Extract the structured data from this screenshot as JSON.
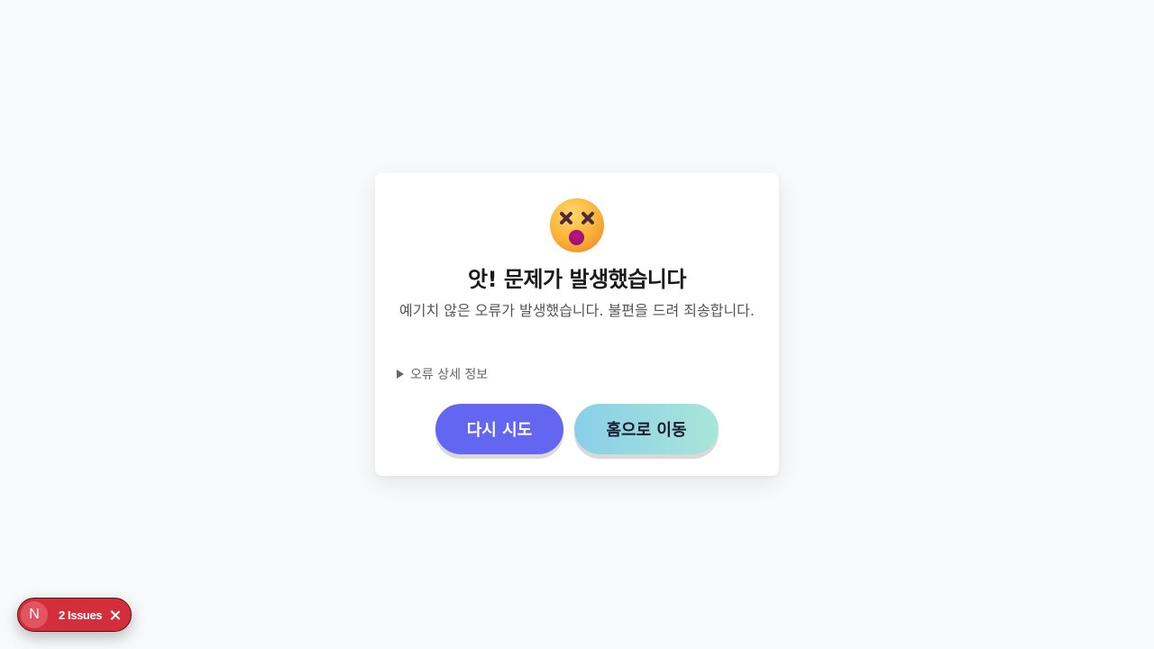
{
  "error_card": {
    "icon": "dizzy-face-emoji-icon",
    "title": "앗! 문제가 발생했습니다",
    "message": "예기치 않은 오류가 발생했습니다. 불편을 드려 죄송합니다.",
    "details_label": "오류 상세 정보",
    "retry_label": "다시 시도",
    "home_label": "홈으로 이동"
  },
  "dev_overlay": {
    "logo_letter": "N",
    "issues_label": "2 Issues"
  },
  "colors": {
    "page_background": "#f8f9fb",
    "retry_button": "#6366f1",
    "home_button_gradient": [
      "#89cfe8",
      "#a8e6d8"
    ],
    "issues_badge": "#d32f3a"
  }
}
